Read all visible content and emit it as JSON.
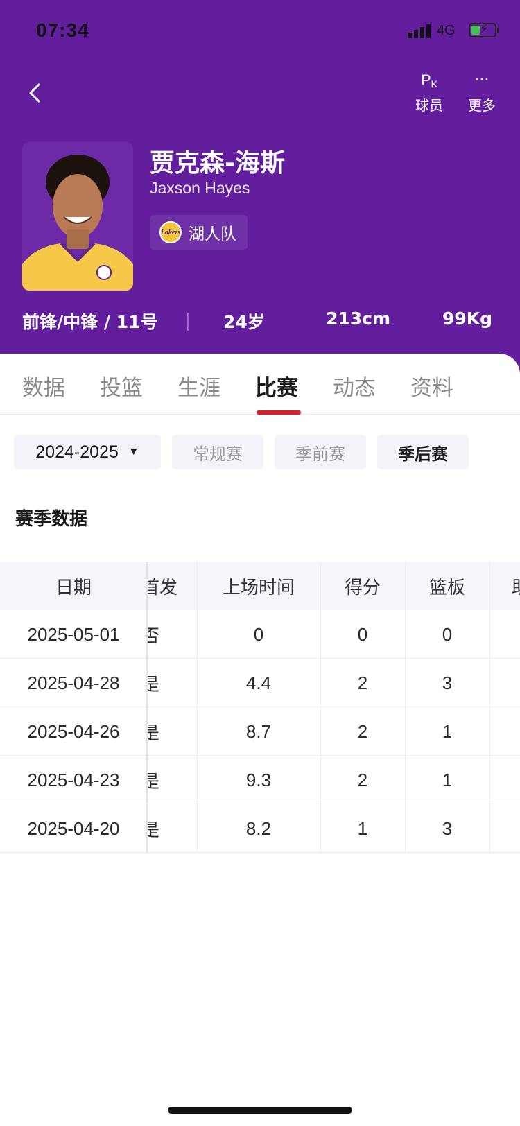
{
  "status_bar": {
    "time": "07:34",
    "network": "4G",
    "battery": "charging",
    "battery_level": 0.3
  },
  "header": {
    "back": "chevron-left-icon",
    "actions": [
      {
        "icon": "PK",
        "label": "球员"
      },
      {
        "icon": "···",
        "label": "更多"
      }
    ],
    "accent_color": "#631e9e"
  },
  "player": {
    "name_cn": "贾克森-海斯",
    "name_en": "Jaxson Hayes",
    "team": "湖人队",
    "team_logo_text": "Lakers",
    "position_number": "前锋/中锋 / 11号",
    "age": "24岁",
    "height": "213cm",
    "weight": "99Kg"
  },
  "tabs": [
    "数据",
    "投篮",
    "生涯",
    "比赛",
    "动态",
    "资料"
  ],
  "active_tab": "比赛",
  "filters": {
    "season": "2024-2025",
    "types": [
      "常规赛",
      "季前赛",
      "季后赛"
    ],
    "selected_type": "季后赛"
  },
  "section_title": "赛季数据",
  "table": {
    "headers": [
      "日期",
      "首发",
      "上场时间",
      "得分",
      "篮板",
      "助"
    ],
    "rows": [
      {
        "date": "2025-05-01",
        "start": "否",
        "minutes": "0",
        "points": "0",
        "rebounds": "0"
      },
      {
        "date": "2025-04-28",
        "start": "是",
        "minutes": "4.4",
        "points": "2",
        "rebounds": "3"
      },
      {
        "date": "2025-04-26",
        "start": "是",
        "minutes": "8.7",
        "points": "2",
        "rebounds": "1"
      },
      {
        "date": "2025-04-23",
        "start": "是",
        "minutes": "9.3",
        "points": "2",
        "rebounds": "1"
      },
      {
        "date": "2025-04-20",
        "start": "是",
        "minutes": "8.2",
        "points": "1",
        "rebounds": "3"
      }
    ]
  }
}
